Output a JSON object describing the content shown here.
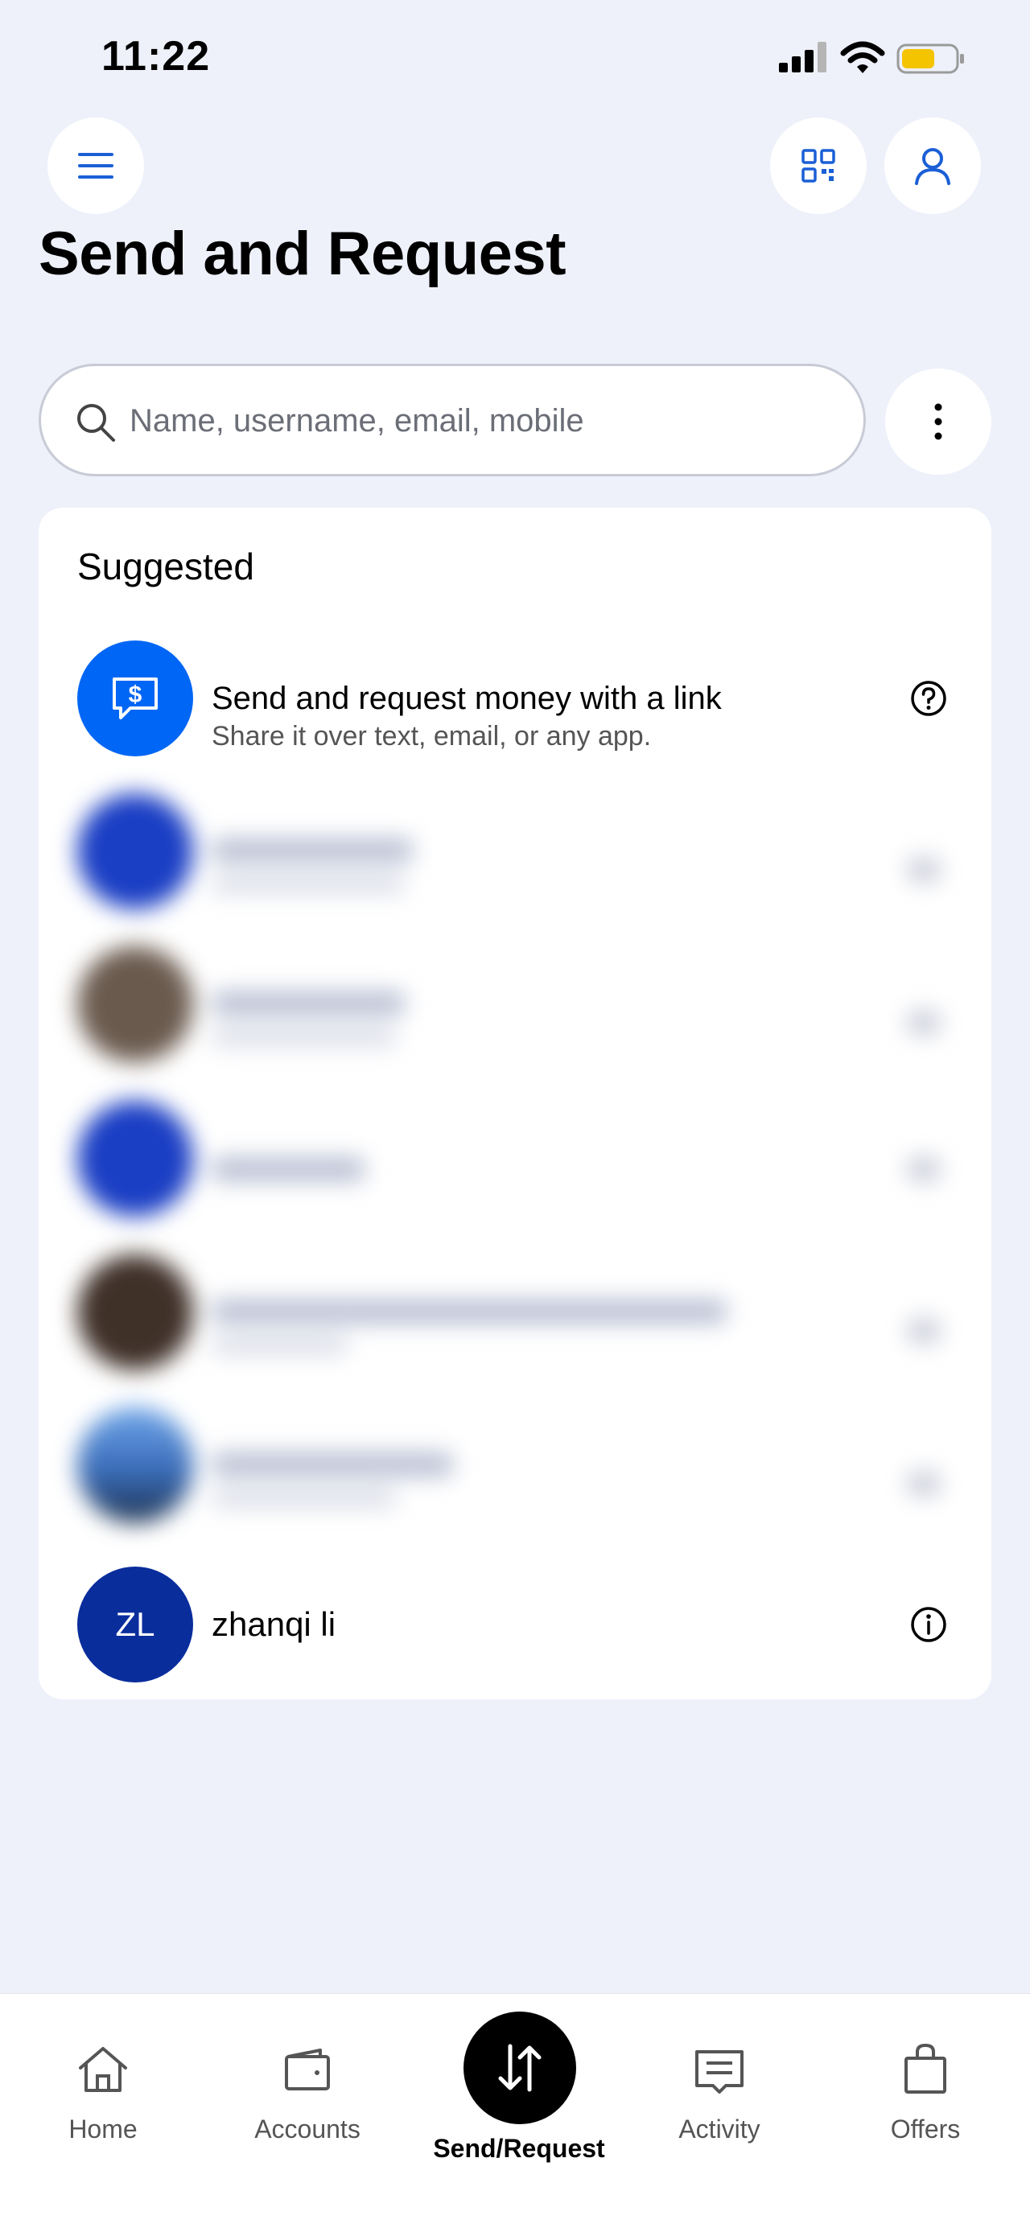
{
  "status_bar": {
    "time": "11:22"
  },
  "header": {
    "title": "Send and Request"
  },
  "search": {
    "placeholder": "Name, username, email, mobile"
  },
  "suggested": {
    "heading": "Suggested",
    "link_item": {
      "title": "Send and request money with a link",
      "subtitle": "Share it over text, email, or any app."
    },
    "contact": {
      "initials": "ZL",
      "name": "zhanqi li"
    }
  },
  "bottom_nav": {
    "home": "Home",
    "accounts": "Accounts",
    "send_request": "Send/Request",
    "activity": "Activity",
    "offers": "Offers"
  },
  "colors": {
    "background": "#eef1fa",
    "accent_blue": "#0066f5",
    "icon_blue": "#1a5fd6",
    "contact_avatar": "#0a2d9c",
    "battery": "#f5c400"
  },
  "icons": [
    "menu-icon",
    "qr-code-icon",
    "profile-icon",
    "search-icon",
    "more-vertical-icon",
    "dollar-chat-icon",
    "help-icon",
    "info-icon",
    "home-icon",
    "wallet-icon",
    "transfer-arrows-icon",
    "receipt-icon",
    "shopping-bag-icon"
  ]
}
